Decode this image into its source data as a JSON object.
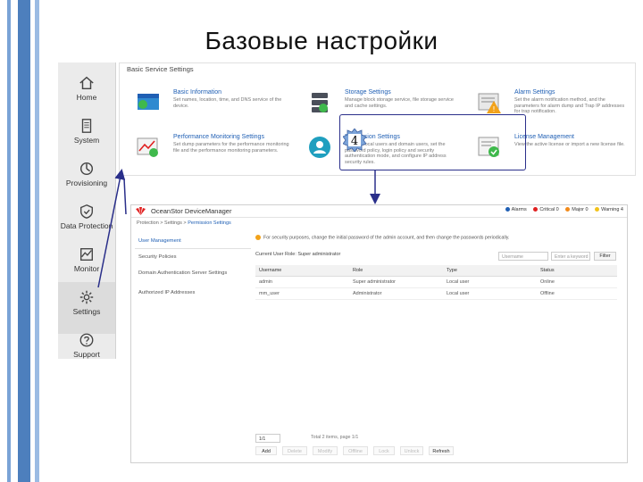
{
  "slide": {
    "title": "Базовые настройки"
  },
  "nav": {
    "items": [
      {
        "label": "Home",
        "icon": "home-icon"
      },
      {
        "label": "System",
        "icon": "system-icon"
      },
      {
        "label": "Provisioning",
        "icon": "provisioning-icon"
      },
      {
        "label": "Data Protection",
        "icon": "data-protection-icon"
      },
      {
        "label": "Monitor",
        "icon": "monitor-icon"
      },
      {
        "label": "Settings",
        "icon": "gear-icon",
        "active": true
      },
      {
        "label": "Support",
        "icon": "support-icon"
      }
    ]
  },
  "basic_settings": {
    "title": "Basic Service Settings",
    "cards": [
      {
        "title": "Basic Information",
        "desc": "Set names, location, time, and DNS service of the device.",
        "icon": "basic-info-icon"
      },
      {
        "title": "Storage Settings",
        "desc": "Manage block storage service, file storage service and cache settings.",
        "icon": "storage-icon"
      },
      {
        "title": "Alarm Settings",
        "desc": "Set the alarm notification method, and the parameters for alarm dump and Trap IP addresses for trap notification.",
        "icon": "alarm-icon"
      },
      {
        "title": "Performance Monitoring Settings",
        "desc": "Set dump parameters for the performance monitoring file and the performance monitoring parameters.",
        "icon": "performance-icon"
      },
      {
        "title": "Permission Settings",
        "desc": "Manage local users and domain users, set the password policy, login policy and security authentication mode, and configure IP address security rules.",
        "icon": "permission-icon"
      },
      {
        "title": "License Management",
        "desc": "View the active license or import a new license file.",
        "icon": "license-icon"
      }
    ],
    "badge": "4"
  },
  "device_manager": {
    "app_name": "OceanStor DeviceManager",
    "alarms": [
      {
        "label": "Alarms",
        "color": "#1f5fb4"
      },
      {
        "label": "Critical 0",
        "color": "#e02020"
      },
      {
        "label": "Major 0",
        "color": "#f28a1a"
      },
      {
        "label": "Warning 4",
        "color": "#f2c21a"
      }
    ],
    "breadcrumb_path": "Protection > Settings > ",
    "breadcrumb_current": "Permission Settings",
    "side_items": [
      "User Management",
      "Security Policies",
      "Domain Authentication Server Settings",
      "Authorized IP Addresses"
    ],
    "tip": "For security purposes, change the initial password of the admin account, and then change the passwords periodically.",
    "current_user": "Current User Role: Super administrator",
    "username_placeholder": "Username",
    "password_placeholder": "Enter a keyword",
    "filter_label": "Filter",
    "table": {
      "headers": [
        "Username",
        "Role",
        "Type",
        "Status"
      ],
      "rows": [
        [
          "admin",
          "Super administrator",
          "Local user",
          "Online"
        ],
        [
          "mm_user",
          "Administrator",
          "Local user",
          "Offline"
        ]
      ]
    },
    "pager": {
      "page": "1/1",
      "info": "Total 2 items, page 1/1"
    },
    "toolbar": [
      "Add",
      "Delete",
      "Modify",
      "Offline",
      "Lock",
      "Unlock",
      "Refresh"
    ]
  }
}
